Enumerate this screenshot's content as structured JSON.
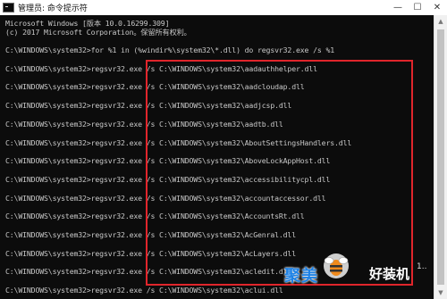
{
  "window": {
    "title": "管理员: 命令提示符",
    "controls": [
      "—",
      "☐",
      "✕"
    ]
  },
  "console": {
    "lines": [
      "Microsoft Windows [版本 10.0.16299.309]",
      "(c) 2017 Microsoft Corporation。保留所有权利。",
      "",
      "C:\\WINDOWS\\system32>for %1 in (%windir%\\system32\\*.dll) do regsvr32.exe /s %1",
      "",
      "C:\\WINDOWS\\system32>regsvr32.exe /s C:\\WINDOWS\\system32\\aadauthhelper.dll",
      "",
      "C:\\WINDOWS\\system32>regsvr32.exe /s C:\\WINDOWS\\system32\\aadcloudap.dll",
      "",
      "C:\\WINDOWS\\system32>regsvr32.exe /s C:\\WINDOWS\\system32\\aadjcsp.dll",
      "",
      "C:\\WINDOWS\\system32>regsvr32.exe /s C:\\WINDOWS\\system32\\aadtb.dll",
      "",
      "C:\\WINDOWS\\system32>regsvr32.exe /s C:\\WINDOWS\\system32\\AboutSettingsHandlers.dll",
      "",
      "C:\\WINDOWS\\system32>regsvr32.exe /s C:\\WINDOWS\\system32\\AboveLockAppHost.dll",
      "",
      "C:\\WINDOWS\\system32>regsvr32.exe /s C:\\WINDOWS\\system32\\accessibilitycpl.dll",
      "",
      "C:\\WINDOWS\\system32>regsvr32.exe /s C:\\WINDOWS\\system32\\accountaccessor.dll",
      "",
      "C:\\WINDOWS\\system32>regsvr32.exe /s C:\\WINDOWS\\system32\\AccountsRt.dll",
      "",
      "C:\\WINDOWS\\system32>regsvr32.exe /s C:\\WINDOWS\\system32\\AcGenral.dll",
      "",
      "C:\\WINDOWS\\system32>regsvr32.exe /s C:\\WINDOWS\\system32\\AcLayers.dll",
      "",
      "C:\\WINDOWS\\system32>regsvr32.exe /s C:\\WINDOWS\\system32\\acledit.dll",
      "",
      "C:\\WINDOWS\\system32>regsvr32.exe /s C:\\WINDOWS\\system32\\aclui.dll"
    ]
  },
  "colors": {
    "console_bg": "#0c0c0c",
    "console_text": "#c8c8c8",
    "highlight_border": "#e0252b",
    "watermark_blue": "#1e82e6"
  },
  "watermark": {
    "brand": "聚美",
    "suffix": "好装机",
    "extra": "1..",
    "logo_icon": "bee-logo-icon"
  }
}
